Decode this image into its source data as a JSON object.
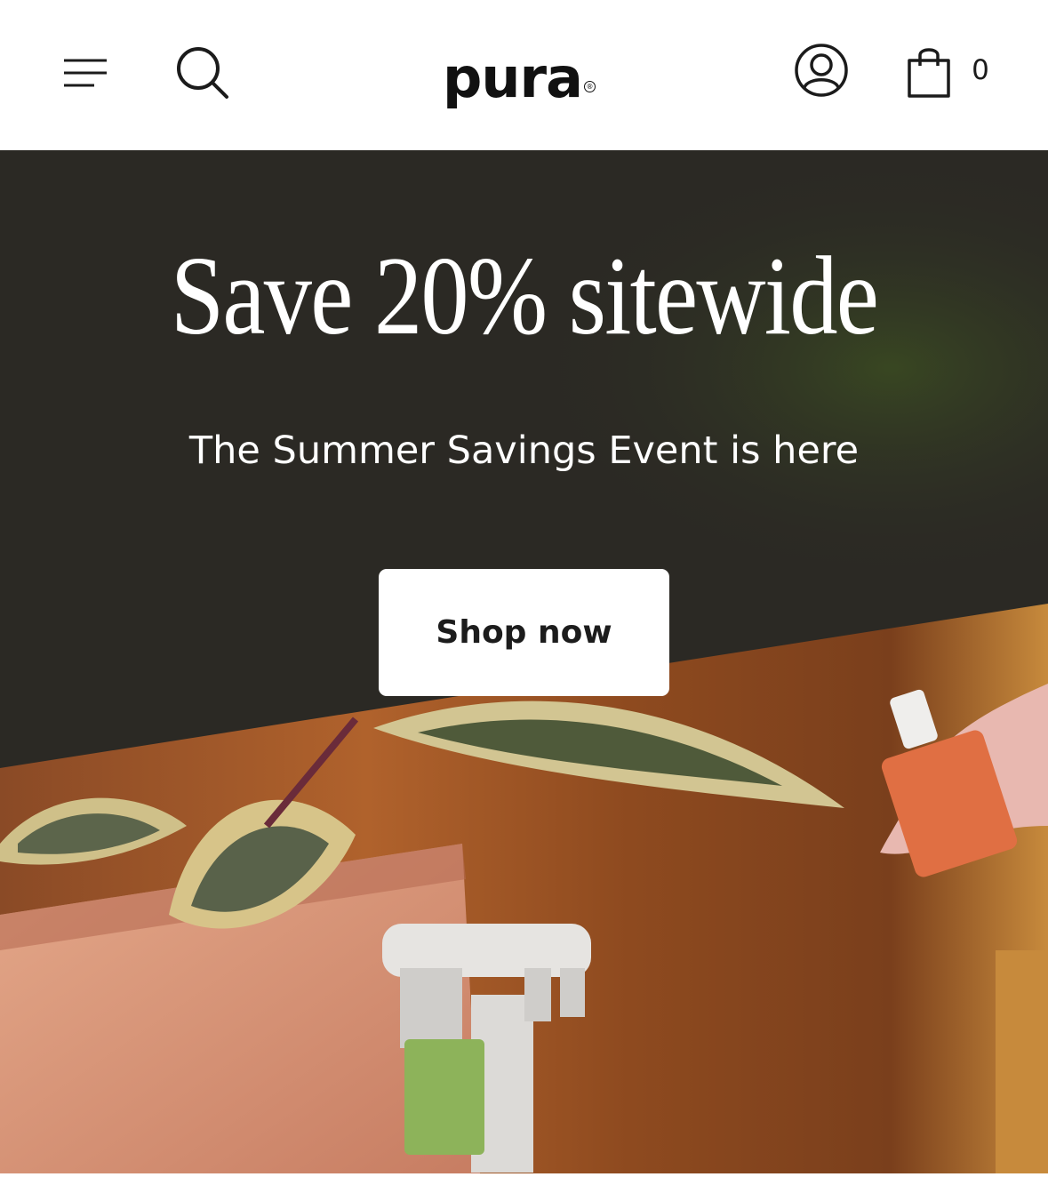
{
  "header": {
    "brand": "pura",
    "brand_mark": "®",
    "cart_count": "0",
    "icons": {
      "menu": "menu-icon",
      "search": "search-icon",
      "account": "account-icon",
      "cart": "shopping-bag-icon"
    }
  },
  "hero": {
    "title": "Save 20% sitewide",
    "subtitle": "The Summer Savings Event is here",
    "cta_label": "Shop now"
  },
  "colors": {
    "hero_background": "#2b2924",
    "button_background": "#ffffff",
    "text_dark": "#1c1c1c",
    "text_light": "#ffffff"
  }
}
